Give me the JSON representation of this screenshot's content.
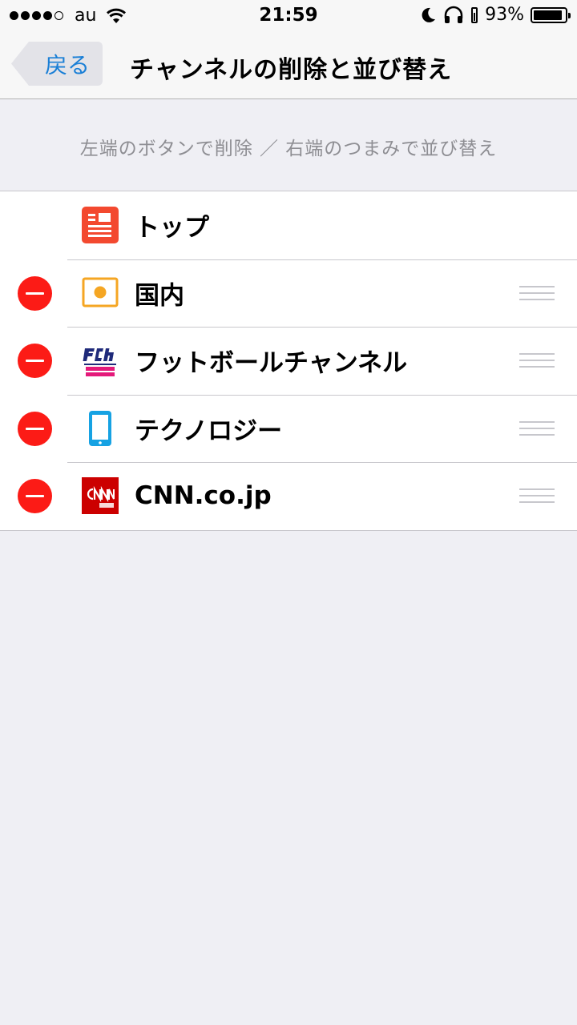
{
  "status_bar": {
    "carrier": "au",
    "time": "21:59",
    "battery_percent": "93%",
    "battery_level": 0.93,
    "signal_bars": 4,
    "signal_max": 5
  },
  "nav": {
    "back_label": "戻る",
    "title": "チャンネルの削除と並び替え"
  },
  "instruction": "左端のボタンで削除 ／ 右端のつまみで並び替え",
  "channels": [
    {
      "label": "トップ",
      "icon": "news-icon",
      "deletable": false,
      "reorderable": false
    },
    {
      "label": "国内",
      "icon": "domestic-icon",
      "deletable": true,
      "reorderable": true
    },
    {
      "label": "フットボールチャンネル",
      "icon": "football-channel-logo",
      "deletable": true,
      "reorderable": true
    },
    {
      "label": "テクノロジー",
      "icon": "smartphone-icon",
      "deletable": true,
      "reorderable": true
    },
    {
      "label": "CNN.co.jp",
      "icon": "cnn-logo",
      "deletable": true,
      "reorderable": true
    }
  ],
  "colors": {
    "accent": "#1a7fd6",
    "delete_red": "#fc1b16",
    "background": "#efeff4"
  }
}
